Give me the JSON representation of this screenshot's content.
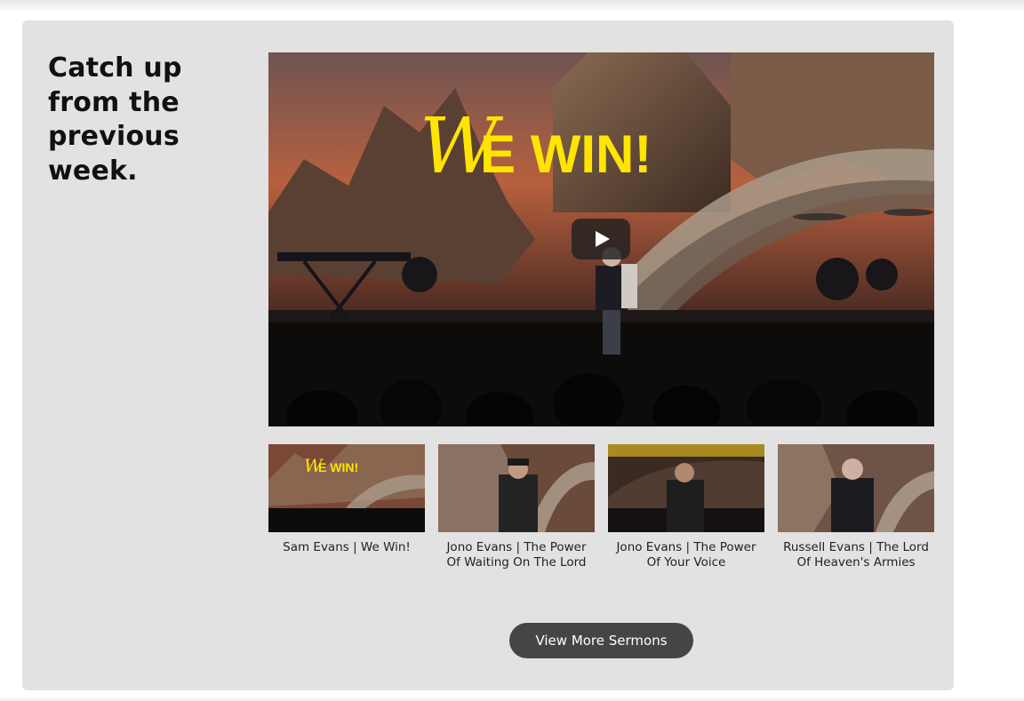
{
  "section": {
    "heading": "Catch up from the previous week."
  },
  "featured_video": {
    "title_overlay_script": "W",
    "title_overlay_text": "E WIN!",
    "play_icon": "play-icon"
  },
  "sermons": [
    {
      "title": "Sam Evans | We Win!",
      "thumb_text": "E WIN!"
    },
    {
      "title": "Jono Evans | The Power Of Waiting On The Lord"
    },
    {
      "title": "Jono Evans | The Power Of Your Voice"
    },
    {
      "title": "Russell Evans | The Lord Of Heaven's Armies"
    }
  ],
  "actions": {
    "view_more_label": "View More Sermons"
  },
  "colors": {
    "panel_bg": "#e2e2e2",
    "button_bg": "#454545",
    "title_yellow": "#ffe500"
  }
}
